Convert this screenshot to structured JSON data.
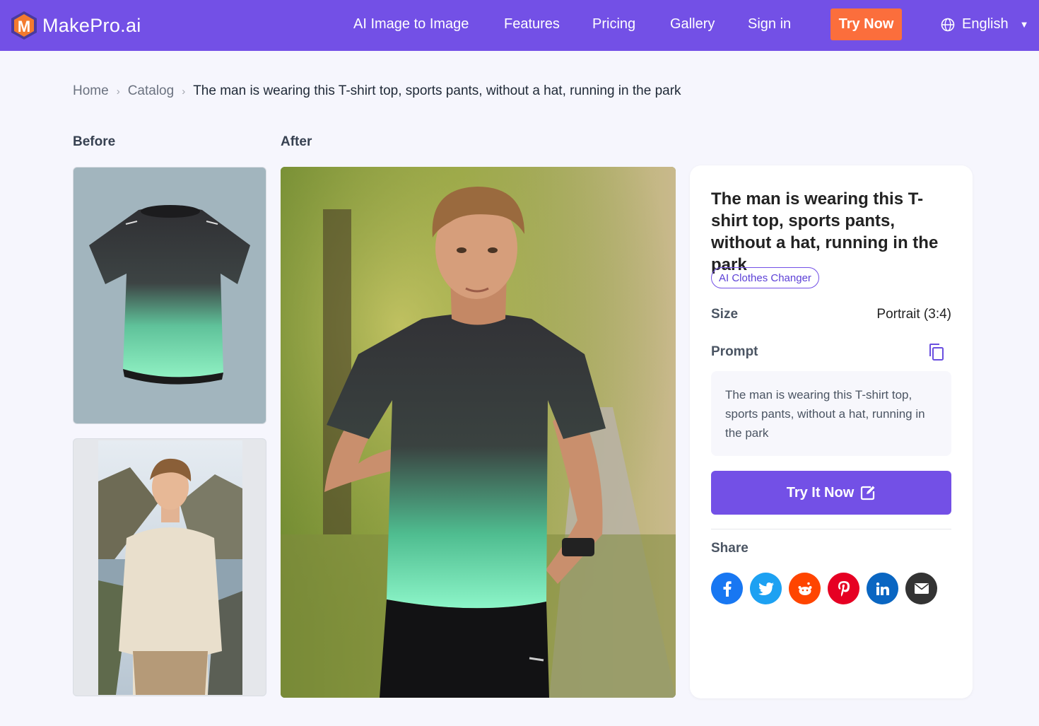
{
  "nav": {
    "brand": "MakePro.ai",
    "links": [
      "AI Image to Image",
      "Features",
      "Pricing",
      "Gallery",
      "Sign in"
    ],
    "cta": "Try Now",
    "language": "English"
  },
  "breadcrumb": {
    "home": "Home",
    "catalog": "Catalog",
    "current": "The man is wearing this T-shirt top, sports pants, without a hat, running in the park"
  },
  "labels": {
    "before": "Before",
    "after": "After"
  },
  "detail": {
    "title": "The man is wearing this T-shirt top, sports pants, without a hat, running in the park",
    "tag": "AI Clothes Changer",
    "size_label": "Size",
    "size_value": "Portrait (3:4)",
    "prompt_label": "Prompt",
    "prompt_text": "The man is wearing this T-shirt top, sports pants, without a hat, running in the park",
    "try_button": "Try It Now",
    "share_label": "Share"
  },
  "share": [
    {
      "name": "facebook",
      "glyph": "f",
      "color": "#1877f2"
    },
    {
      "name": "twitter",
      "glyph": "t",
      "color": "#1da1f2"
    },
    {
      "name": "reddit",
      "glyph": "r",
      "color": "#ff4500"
    },
    {
      "name": "pinterest",
      "glyph": "p",
      "color": "#e60023"
    },
    {
      "name": "linkedin",
      "glyph": "in",
      "color": "#0a66c2"
    },
    {
      "name": "email",
      "glyph": "✉",
      "color": "#333333"
    }
  ],
  "colors": {
    "brand": "#7350e6",
    "cta": "#fb6e3c"
  }
}
